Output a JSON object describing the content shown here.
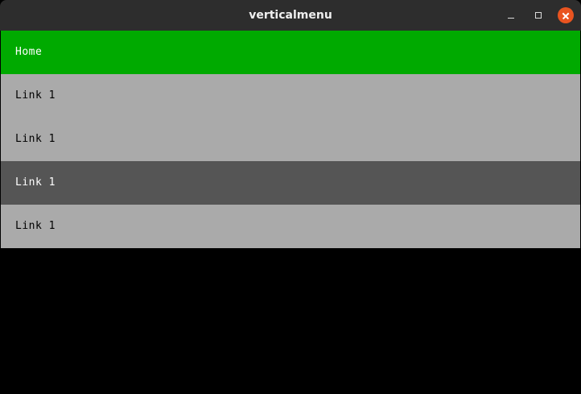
{
  "window": {
    "title": "verticalmenu"
  },
  "controls": {
    "minimize": "minimize-icon",
    "maximize": "maximize-icon",
    "close": "close-icon"
  },
  "colors": {
    "titlebar": "#2d2d2d",
    "active": "#00aa00",
    "normal": "#aaaaaa",
    "hover": "#555555",
    "background": "#000000",
    "close_button": "#e95420"
  },
  "menu": {
    "items": [
      {
        "label": "Home",
        "state": "active",
        "bg": "#00aa00",
        "color": "#ffffff"
      },
      {
        "label": "Link 1",
        "state": "normal",
        "bg": "#aaaaaa",
        "color": "#000000"
      },
      {
        "label": "Link 1",
        "state": "normal",
        "bg": "#aaaaaa",
        "color": "#000000"
      },
      {
        "label": "Link 1",
        "state": "hover",
        "bg": "#555555",
        "color": "#ffffff"
      },
      {
        "label": "Link 1",
        "state": "normal",
        "bg": "#aaaaaa",
        "color": "#000000"
      }
    ]
  }
}
